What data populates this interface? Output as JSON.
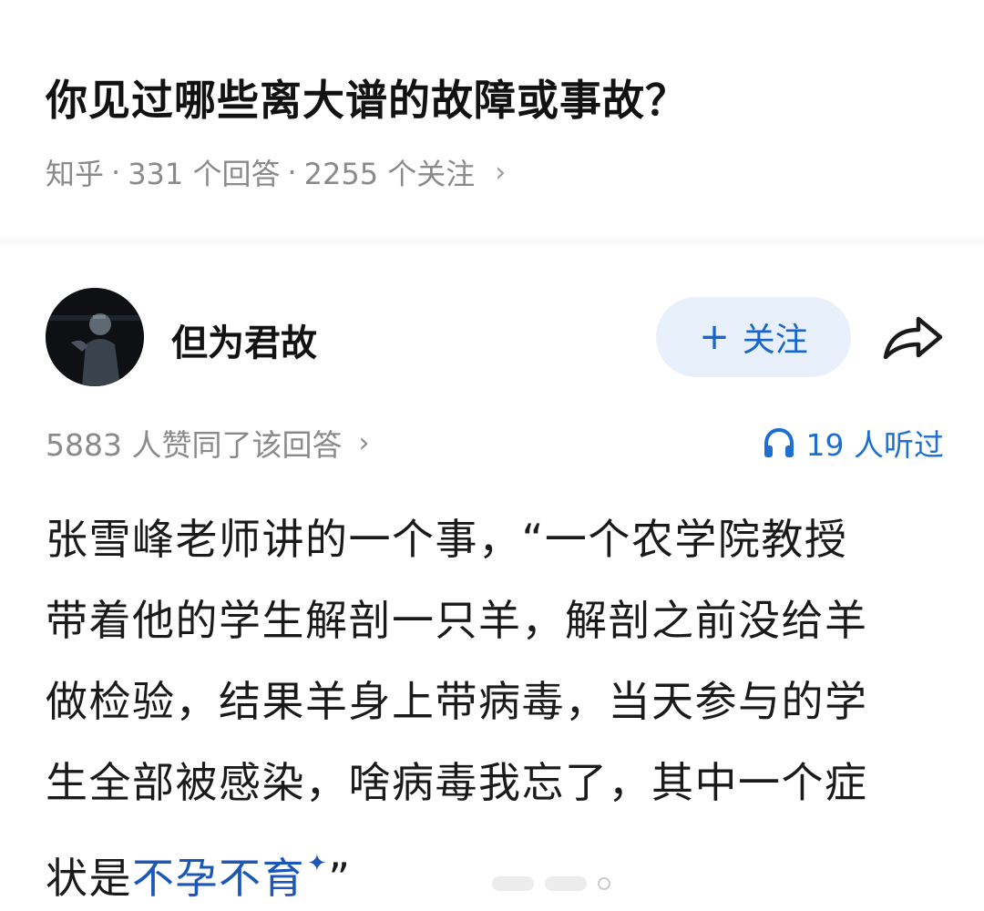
{
  "question": {
    "title": "你见过哪些离大谱的故障或事故？",
    "source": "知乎",
    "answers": "331 个回答",
    "followers": "2255 个关注",
    "separator": "·",
    "chevron": "›"
  },
  "author": {
    "name": "但为君故",
    "avatar_icon": "avatar-portrait-icon",
    "follow_label": "关注",
    "follow_icon": "+",
    "share_icon": "share-arrow-icon"
  },
  "answer": {
    "approve_text": "5883 人赞同了该回答",
    "approve_chevron": "›",
    "listen_text": "19 人听过",
    "listen_icon": "headphones-icon",
    "lines": [
      "张雪峰老师讲的一个事，“一个农学院教授",
      "带着他的学生解剖一只羊，解剖之前没给羊",
      "做检验，结果羊身上带病毒，当天参与的学",
      "生全部被感染，啥病毒我忘了，其中一个症"
    ],
    "last_line_prefix": "状是",
    "keyword": "不孕不育",
    "keyword_mark": "✦",
    "last_line_suffix": "”"
  },
  "colors": {
    "link_blue": "#1c56b8",
    "follow_bg": "#e8f0fb",
    "meta_gray": "#8a8a8a"
  }
}
